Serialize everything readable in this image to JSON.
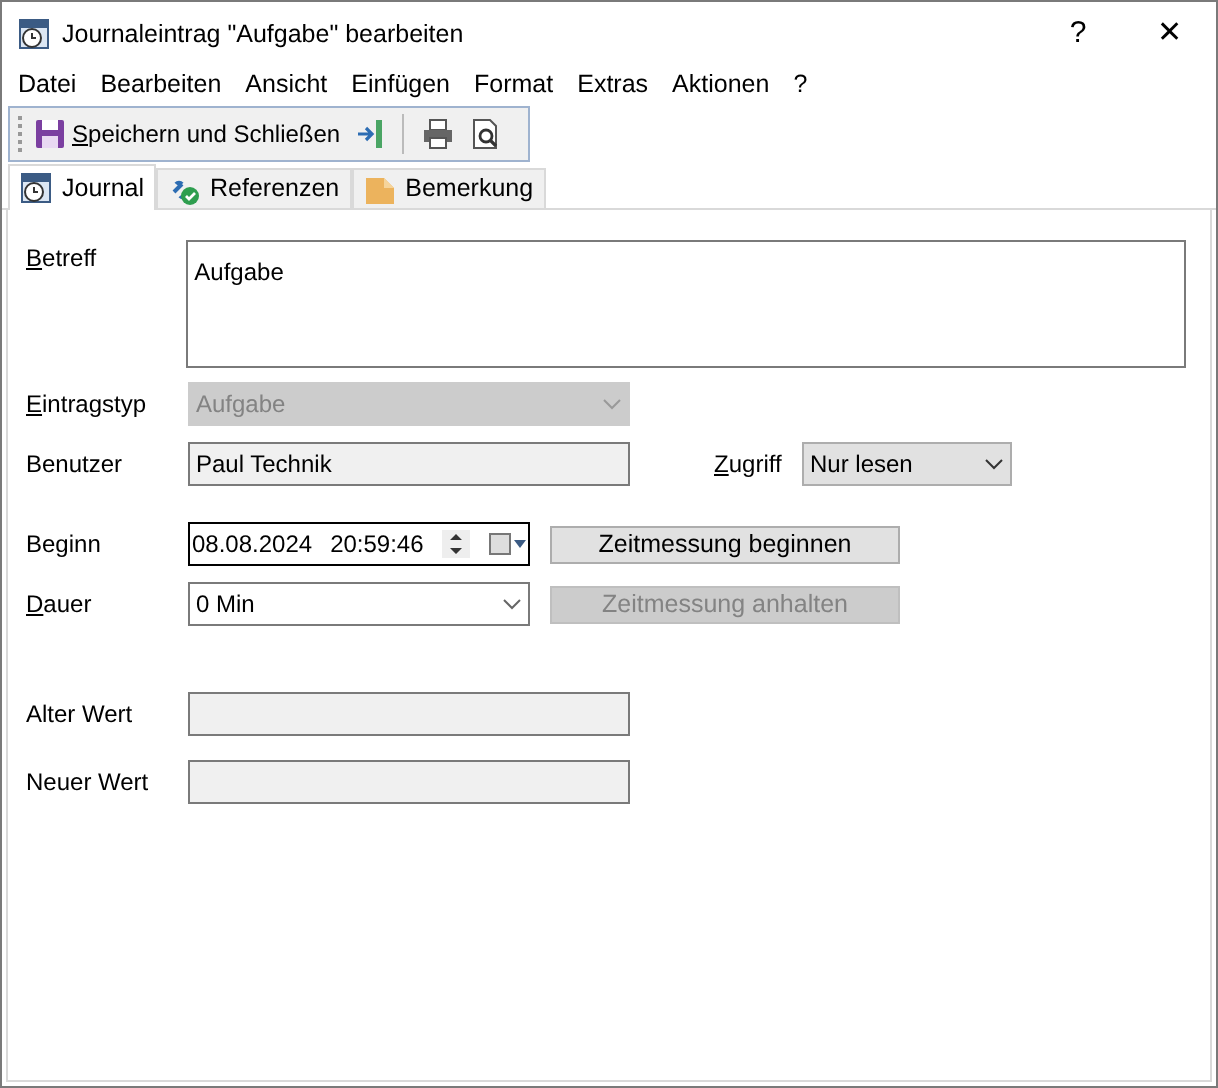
{
  "window": {
    "title": "Journaleintrag \"Aufgabe\" bearbeiten",
    "help": "?",
    "close": "✕"
  },
  "menu": [
    "Datei",
    "Bearbeiten",
    "Ansicht",
    "Einfügen",
    "Format",
    "Extras",
    "Aktionen",
    "?"
  ],
  "toolbar": {
    "save_label": "Speichern und Schließen",
    "save_mnemonic": true
  },
  "tabs": [
    {
      "label": "Journal",
      "selected": true,
      "kind": "journal"
    },
    {
      "label": "Referenzen",
      "selected": false,
      "kind": "links"
    },
    {
      "label": "Bemerkung",
      "selected": false,
      "kind": "note"
    }
  ],
  "form": {
    "subject": {
      "label": "Betreff",
      "mnemonic": true,
      "value": "Aufgabe"
    },
    "entry_type": {
      "label": "Eintragstyp",
      "mnemonic": true,
      "value": "Aufgabe",
      "disabled": true
    },
    "user": {
      "label": "Benutzer",
      "mnemonic": false,
      "value": "Paul Technik"
    },
    "access": {
      "label": "Zugriff",
      "mnemonic": true,
      "value": "Nur lesen"
    },
    "start": {
      "label": "Beginn",
      "mnemonic": false,
      "date": "08.08.2024",
      "time": "20:59:46"
    },
    "start_button": {
      "label": "Zeitmessung beginnen",
      "disabled": false
    },
    "duration": {
      "label": "Dauer",
      "mnemonic": true,
      "value": "0 Min"
    },
    "stop_button": {
      "label": "Zeitmessung anhalten",
      "disabled": true
    },
    "old_value": {
      "label": "Alter Wert",
      "mnemonic": false
    },
    "new_value": {
      "label": "Neuer Wert",
      "mnemonic": false
    }
  }
}
